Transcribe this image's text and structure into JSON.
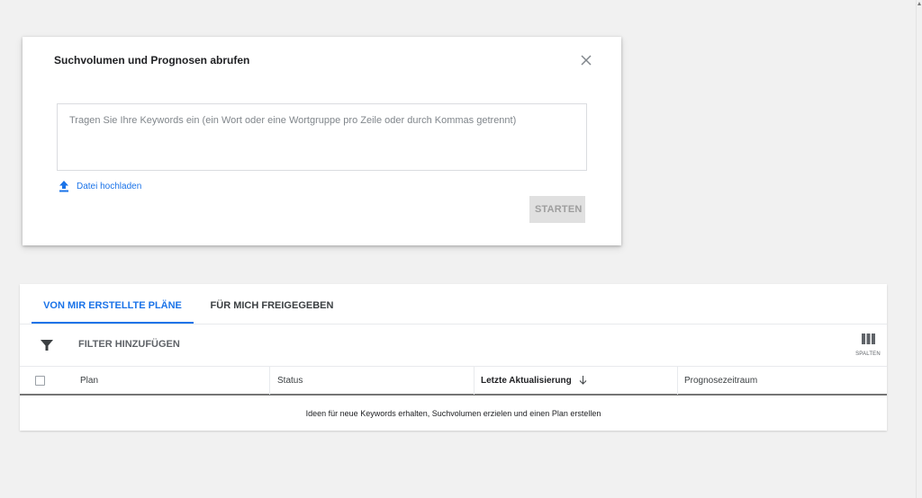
{
  "dialog": {
    "title": "Suchvolumen und Prognosen abrufen",
    "close_icon": "close-icon",
    "keyword_input": {
      "value": "",
      "placeholder": "Tragen Sie Ihre Keywords ein (ein Wort oder eine Wortgruppe pro Zeile oder durch Kommas getrennt)"
    },
    "upload_label": "Datei hochladen",
    "upload_icon": "upload-icon",
    "start_label": "STARTEN"
  },
  "plans": {
    "tabs": [
      {
        "label": "VON MIR ERSTELLTE PLÄNE",
        "active": true
      },
      {
        "label": "FÜR MICH FREIGEGEBEN",
        "active": false
      }
    ],
    "filter": {
      "icon": "filter-icon",
      "label": "FILTER HINZUFÜGEN"
    },
    "columns_button": {
      "icon": "columns-icon",
      "label": "SPALTEN"
    },
    "table": {
      "headers": [
        {
          "label": "Plan",
          "sorted": false
        },
        {
          "label": "Status",
          "sorted": false
        },
        {
          "label": "Letzte Aktualisierung",
          "sorted": true,
          "sort_direction": "descending"
        },
        {
          "label": "Prognosezeitraum",
          "sorted": false
        }
      ],
      "empty_message": "Ideen für neue Keywords erhalten, Suchvolumen erzielen und einen Plan erstellen"
    }
  },
  "colors": {
    "page_background": "#f1f1f1",
    "accent": "#1a73e8",
    "disabled_button": "#e0e0e0",
    "disabled_text": "#9e9e9e"
  }
}
